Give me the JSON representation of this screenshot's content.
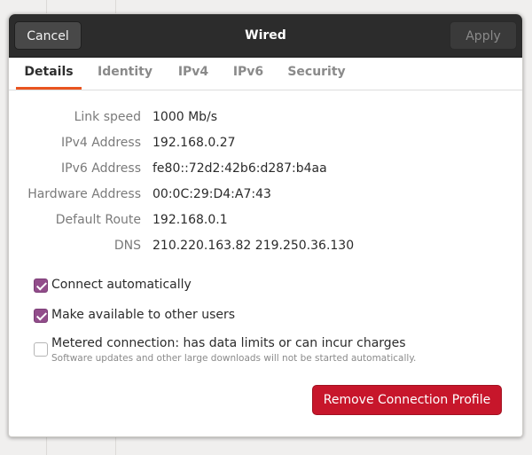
{
  "header": {
    "cancel_label": "Cancel",
    "title": "Wired",
    "apply_label": "Apply"
  },
  "tabs": [
    {
      "label": "Details",
      "active": true
    },
    {
      "label": "Identity",
      "active": false
    },
    {
      "label": "IPv4",
      "active": false
    },
    {
      "label": "IPv6",
      "active": false
    },
    {
      "label": "Security",
      "active": false
    }
  ],
  "details": [
    {
      "label": "Link speed",
      "value": "1000 Mb/s"
    },
    {
      "label": "IPv4 Address",
      "value": "192.168.0.27"
    },
    {
      "label": "IPv6 Address",
      "value": "fe80::72d2:42b6:d287:b4aa"
    },
    {
      "label": "Hardware Address",
      "value": "00:0C:29:D4:A7:43"
    },
    {
      "label": "Default Route",
      "value": "192.168.0.1"
    },
    {
      "label": "DNS",
      "value": "210.220.163.82 219.250.36.130"
    }
  ],
  "options": {
    "connect_automatically": {
      "label": "Connect automatically",
      "checked": true
    },
    "available_to_others": {
      "label": "Make available to other users",
      "checked": true
    },
    "metered": {
      "label": "Metered connection: has data limits or can incur charges",
      "sublabel": "Software updates and other large downloads will not be started automatically.",
      "checked": false
    }
  },
  "remove_label": "Remove Connection Profile",
  "colors": {
    "accent": "#e95420",
    "checkbox": "#924d8b",
    "destructive": "#c7162b",
    "header_bg": "#2c2c2c"
  }
}
